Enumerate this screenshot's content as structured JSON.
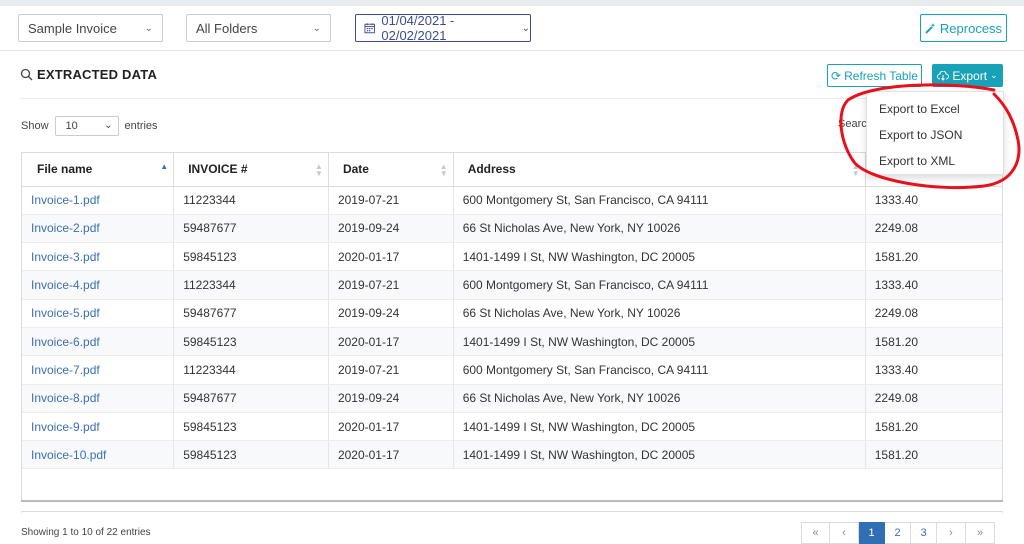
{
  "filters": {
    "invoice_type": "Sample Invoice",
    "folder": "All Folders",
    "date_range": "01/04/2021 - 02/02/2021",
    "reprocess_label": "Reprocess"
  },
  "section": {
    "title": "EXTRACTED DATA",
    "refresh_label": "Refresh Table",
    "export_label": "Export"
  },
  "export_menu": {
    "items": [
      "Export to Excel",
      "Export to JSON",
      "Export to XML"
    ]
  },
  "length_control": {
    "prefix": "Show",
    "value": "10",
    "suffix": "entries",
    "search_label": "Search"
  },
  "table": {
    "columns": [
      "File name",
      "INVOICE #",
      "Date",
      "Address",
      ""
    ],
    "rows": [
      [
        "Invoice-1.pdf",
        "11223344",
        "2019-07-21",
        "600 Montgomery St, San Francisco, CA 94111",
        "1333.40"
      ],
      [
        "Invoice-2.pdf",
        "59487677",
        "2019-09-24",
        "66 St Nicholas Ave, New York, NY 10026",
        "2249.08"
      ],
      [
        "Invoice-3.pdf",
        "59845123",
        "2020-01-17",
        "1401-1499 I St, NW Washington, DC 20005",
        "1581.20"
      ],
      [
        "Invoice-4.pdf",
        "11223344",
        "2019-07-21",
        "600 Montgomery St, San Francisco, CA 94111",
        "1333.40"
      ],
      [
        "Invoice-5.pdf",
        "59487677",
        "2019-09-24",
        "66 St Nicholas Ave, New York, NY 10026",
        "2249.08"
      ],
      [
        "Invoice-6.pdf",
        "59845123",
        "2020-01-17",
        "1401-1499 I St, NW Washington, DC 20005",
        "1581.20"
      ],
      [
        "Invoice-7.pdf",
        "11223344",
        "2019-07-21",
        "600 Montgomery St, San Francisco, CA 94111",
        "1333.40"
      ],
      [
        "Invoice-8.pdf",
        "59487677",
        "2019-09-24",
        "66 St Nicholas Ave, New York, NY 10026",
        "2249.08"
      ],
      [
        "Invoice-9.pdf",
        "59845123",
        "2020-01-17",
        "1401-1499 I St, NW Washington, DC 20005",
        "1581.20"
      ],
      [
        "Invoice-10.pdf",
        "59845123",
        "2020-01-17",
        "1401-1499 I St, NW Washington, DC 20005",
        "1581.20"
      ]
    ]
  },
  "footer": {
    "info": "Showing 1 to 10 of 22 entries",
    "pages": [
      "«",
      "‹",
      "1",
      "2",
      "3",
      "›",
      "»"
    ],
    "active_page": "1"
  },
  "colors": {
    "accent": "#17a2b8",
    "link": "#3c6fb3",
    "annotation": "#e8111b"
  }
}
